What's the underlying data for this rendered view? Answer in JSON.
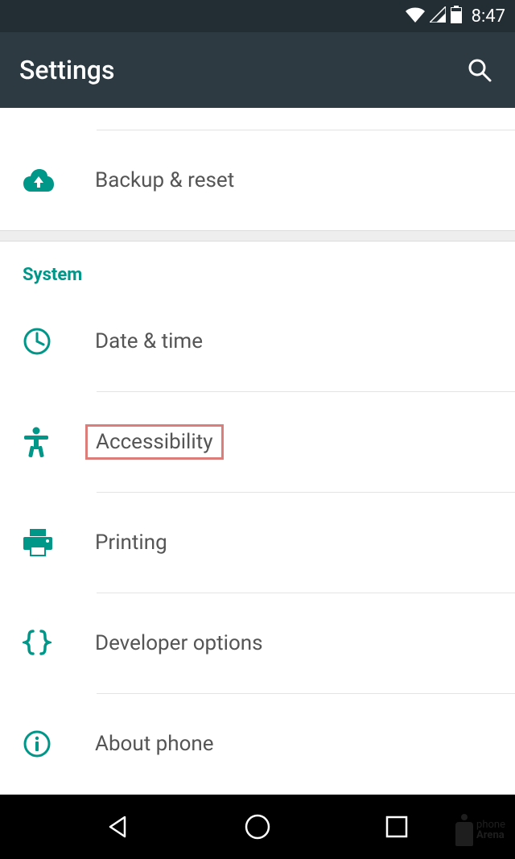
{
  "status": {
    "time": "8:47"
  },
  "appbar": {
    "title": "Settings"
  },
  "rows": {
    "backup": "Backup & reset",
    "datetime": "Date & time",
    "accessibility": "Accessibility",
    "printing": "Printing",
    "developer": "Developer options",
    "about": "About phone"
  },
  "section": {
    "system": "System"
  },
  "watermark": {
    "line1": "phone",
    "line2": "Arena"
  },
  "colors": {
    "accent": "#009688",
    "highlight": "#dd7d7a"
  }
}
